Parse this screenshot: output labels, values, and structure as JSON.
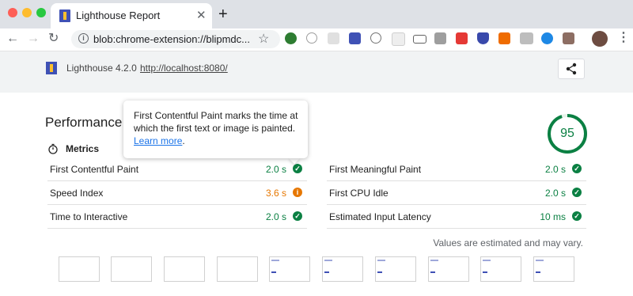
{
  "tab": {
    "title": "Lighthouse Report",
    "close": "✕",
    "new_tab": "+"
  },
  "toolbar": {
    "back": "←",
    "forward": "→",
    "reload": "↻",
    "url": "blob:chrome-extension://blipmdc...",
    "star": "☆",
    "menu": "⋮"
  },
  "lighthouse": {
    "version": "Lighthouse 4.2.0",
    "url": "http://localhost:8080/"
  },
  "performance": {
    "title": "Performance",
    "score": "95",
    "score_fraction": 0.95,
    "metrics_heading": "Metrics",
    "left_metrics": [
      {
        "name": "First Contentful Paint",
        "value": "2.0 s",
        "status": "pass"
      },
      {
        "name": "Speed Index",
        "value": "3.6 s",
        "status": "average"
      },
      {
        "name": "Time to Interactive",
        "value": "2.0 s",
        "status": "pass"
      }
    ],
    "right_metrics": [
      {
        "name": "First Meaningful Paint",
        "value": "2.0 s",
        "status": "pass"
      },
      {
        "name": "First CPU Idle",
        "value": "2.0 s",
        "status": "pass"
      },
      {
        "name": "Estimated Input Latency",
        "value": "10 ms",
        "status": "pass"
      }
    ],
    "note": "Values are estimated and may vary."
  },
  "tooltip": {
    "text": "First Contentful Paint marks the time at which the first text or image is painted. ",
    "link": "Learn more",
    "suffix": "."
  },
  "colors": {
    "pass": "#0b8043",
    "average": "#e67700",
    "tab_strip": "#dee1e6"
  }
}
